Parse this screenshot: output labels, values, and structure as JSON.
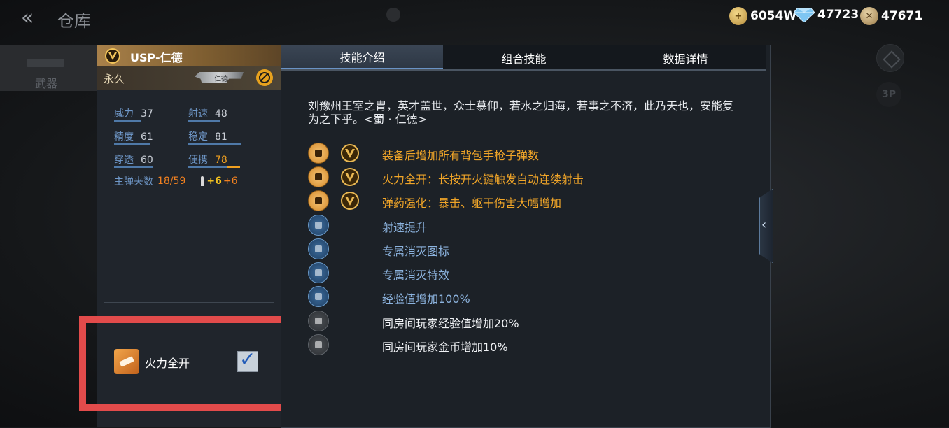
{
  "header": {
    "back_glyph": "«",
    "title": "仓库"
  },
  "currency": {
    "gold": "6054W",
    "diamond": "47723",
    "medal": "47671"
  },
  "side_tab": {
    "label": "武器"
  },
  "right_icons": {
    "view_mode": "3P"
  },
  "weapon": {
    "name": "USP-仁德",
    "duration": "永久",
    "thumb_label": "仁德",
    "stats": [
      {
        "label": "威力",
        "value": "37",
        "level": 0.37
      },
      {
        "label": "射速",
        "value": "48",
        "level": 0.48
      },
      {
        "label": "精度",
        "value": "61",
        "level": 0.61
      },
      {
        "label": "稳定",
        "value": "81",
        "level": 0.81
      },
      {
        "label": "穿透",
        "value": "60",
        "level": 0.6
      },
      {
        "label": "便携",
        "value": "78",
        "level": 0.78
      }
    ],
    "ammo": {
      "label": "主弹夹数",
      "current": "18",
      "separator": "/",
      "total": "59",
      "bonus1": "+6",
      "bonus2": "+6"
    }
  },
  "skill_toggle": {
    "label": "火力全开",
    "checked": true,
    "check_glyph": "✓"
  },
  "tabs": [
    {
      "label": "技能介绍",
      "active": true
    },
    {
      "label": "组合技能",
      "active": false
    },
    {
      "label": "数据详情",
      "active": false
    }
  ],
  "description": "刘豫州王室之胄，英才盖世，众士慕仰，若水之归海，若事之不济，此乃天也，安能复为之下乎。<蜀 · 仁德>",
  "skills": [
    {
      "text": "装备后增加所有背包手枪子弹数",
      "style": "gold",
      "icon": "pistol-icon",
      "badge": true
    },
    {
      "text": "火力全开：长按开火键触发自动连续射击",
      "style": "gold",
      "icon": "fire-icon",
      "badge": true
    },
    {
      "text": "弹药强化：暴击、躯干伤害大幅增加",
      "style": "gold",
      "icon": "ammo-icon",
      "badge": true
    },
    {
      "text": "射速提升",
      "style": "blue",
      "icon": "bullet-speed-icon",
      "badge": false
    },
    {
      "text": "专属消灭图标",
      "style": "blue",
      "icon": "kill-mark-icon",
      "badge": false
    },
    {
      "text": "专属消灭特效",
      "style": "blue",
      "icon": "kill-effect-icon",
      "badge": false
    },
    {
      "text": "经验值增加100%",
      "style": "blue",
      "icon": "exp-icon",
      "badge": false
    },
    {
      "text": "同房间玩家经验值增加20%",
      "style": "white",
      "icon": "room-exp-icon",
      "badge": false
    },
    {
      "text": "同房间玩家金币增加10%",
      "style": "white",
      "icon": "room-gold-icon",
      "badge": false
    }
  ],
  "colors": {
    "accent_gold": "#f0a528",
    "accent_blue": "#8cb3de",
    "highlight_red": "#e24b4b"
  }
}
